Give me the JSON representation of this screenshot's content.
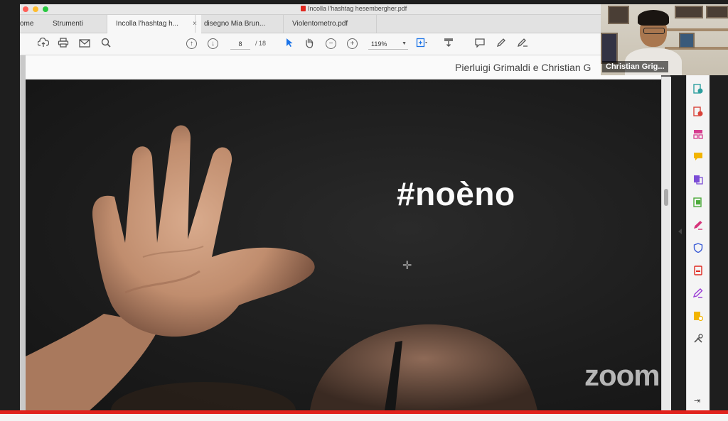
{
  "window": {
    "title": "Incolla l'hashtag hesembergher.pdf"
  },
  "tabs": [
    {
      "label": "ome",
      "kind": "nav"
    },
    {
      "label": "Strumenti",
      "kind": "nav"
    },
    {
      "label": "Incolla l'hashtag h...",
      "kind": "doc",
      "active": true,
      "close": "×"
    },
    {
      "label": "disegno Mia Brun...",
      "kind": "doc"
    },
    {
      "label": "Violentometro.pdf",
      "kind": "doc"
    }
  ],
  "toolbar": {
    "page_current": "8",
    "page_separator": "/ 18",
    "zoom": "119%"
  },
  "page": {
    "header_text": "Pierluigi Grimaldi e Christian G",
    "slide_hashtag": "#noèno"
  },
  "webcam": {
    "participant_name": "Christian Grig..."
  },
  "watermark": {
    "text": "zoom"
  },
  "right_pane_icons": [
    {
      "name": "export-pdf-icon",
      "color": "#2c9f9f"
    },
    {
      "name": "create-pdf-icon",
      "color": "#d9433a"
    },
    {
      "name": "organize-pages-icon",
      "color": "#d63c8f"
    },
    {
      "name": "comment-icon",
      "color": "#f2b400"
    },
    {
      "name": "combine-files-icon",
      "color": "#7b4cd6"
    },
    {
      "name": "edit-pdf-icon",
      "color": "#4caa3a"
    },
    {
      "name": "fill-sign-icon",
      "color": "#d6337a"
    },
    {
      "name": "protect-icon",
      "color": "#3b5cd6"
    },
    {
      "name": "pdf-icon",
      "color": "#e0281f"
    },
    {
      "name": "sign-icon",
      "color": "#9a3ad6"
    },
    {
      "name": "stamp-icon",
      "color": "#f2b400"
    },
    {
      "name": "tools-icon",
      "color": "#555555"
    }
  ]
}
